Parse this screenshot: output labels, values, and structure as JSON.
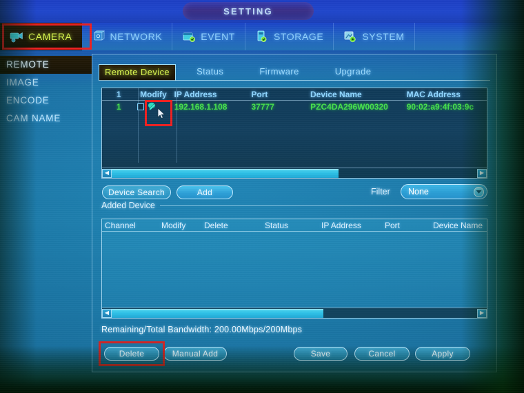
{
  "titlebar": {
    "title": "SETTING"
  },
  "menu": {
    "items": [
      {
        "label": "CAMERA",
        "icon": "camera-icon",
        "active": true
      },
      {
        "label": "NETWORK",
        "icon": "network-icon",
        "active": false
      },
      {
        "label": "EVENT",
        "icon": "event-icon",
        "active": false
      },
      {
        "label": "STORAGE",
        "icon": "storage-icon",
        "active": false
      },
      {
        "label": "SYSTEM",
        "icon": "system-icon",
        "active": false
      }
    ]
  },
  "sidebar": {
    "items": [
      {
        "label": "REMOTE",
        "active": true
      },
      {
        "label": "IMAGE",
        "active": false
      },
      {
        "label": "ENCODE",
        "active": false
      },
      {
        "label": "CAM NAME",
        "active": false
      }
    ]
  },
  "tabs": [
    {
      "label": "Remote Device",
      "active": true
    },
    {
      "label": "Status",
      "active": false
    },
    {
      "label": "Firmware",
      "active": false
    },
    {
      "label": "Upgrade",
      "active": false
    }
  ],
  "device_table": {
    "headers": {
      "index": "1",
      "modify": "Modify",
      "ip": "IP Address",
      "port": "Port",
      "device_name": "Device Name",
      "mac": "MAC Address"
    },
    "rows": [
      {
        "index": "1",
        "ip": "192.168.1.108",
        "port": "37777",
        "device_name": "PZC4DA296W00320",
        "mac": "90:02:a9:4f:03:9c"
      }
    ]
  },
  "controls": {
    "device_search": "Device Search",
    "add": "Add",
    "filter_label": "Filter",
    "filter_value": "None",
    "added_device_label": "Added Device"
  },
  "added_table": {
    "headers": [
      "Channel",
      "Modify",
      "Delete",
      "Status",
      "IP Address",
      "Port",
      "Device Name"
    ],
    "rows": []
  },
  "bandwidth": {
    "text": "Remaining/Total Bandwidth: 200.00Mbps/200Mbps"
  },
  "footer": {
    "delete": "Delete",
    "manual_add": "Manual Add",
    "save": "Save",
    "cancel": "Cancel",
    "apply": "Apply"
  },
  "colors": {
    "panel_bg": "#2288b8",
    "table_bg": "#123f5e",
    "accent_text": "#8fd6ff",
    "row_text": "#46e04c",
    "highlight_red": "#ef2020",
    "active_tab_text": "#d7f24f"
  },
  "scrollbars": {
    "device_thumb_pct": 62,
    "added_thumb_pct": 58
  }
}
